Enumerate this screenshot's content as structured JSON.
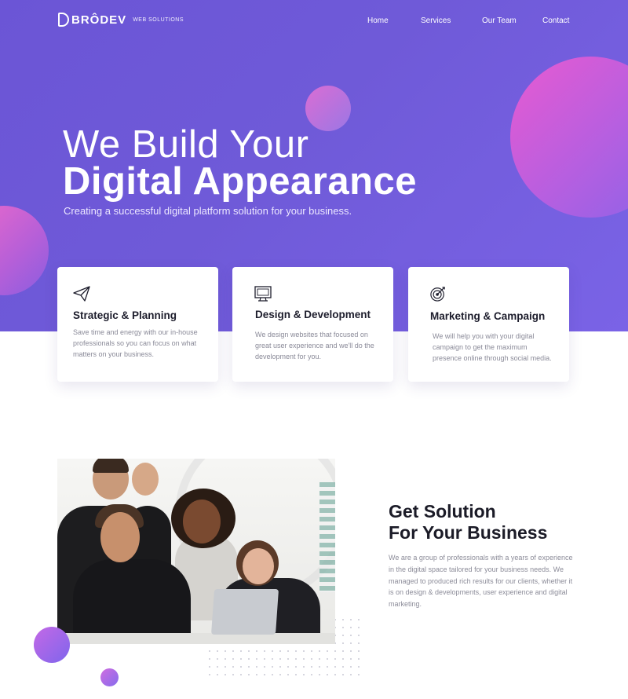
{
  "header": {
    "logo_text": "BRÔDEV",
    "logo_sub": "WEB SOLUTIONS",
    "nav": {
      "home": "Home",
      "services": "Services",
      "team": "Our Team",
      "contact": "Contact"
    }
  },
  "hero": {
    "title_line1": "We Build Your",
    "title_line2": "Digital Appearance",
    "subtitle": "Creating a successful digital platform solution for your business."
  },
  "services": {
    "items": [
      {
        "icon": "paper-plane-icon",
        "title": "Strategic & Planning",
        "text": "Save time and energy with our in-house professionals so you can focus on what matters on your business."
      },
      {
        "icon": "monitor-code-icon",
        "title": "Design & Development",
        "text": "We design websites that focused on great user experience and we'll do the development for you."
      },
      {
        "icon": "target-icon",
        "title": "Marketing & Campaign",
        "text": "We will help you with your digital campaign to get the maximum presence online through social media."
      }
    ]
  },
  "about": {
    "title_line1": "Get Solution",
    "title_line2": "For Your Business",
    "text": "We are a group of professionals with a years of experience in the digital space tailored for your business needs. We managed to produced rich results for our clients, whether it is on design & developments, user experience and digital marketing."
  },
  "colors": {
    "hero_gradient_start": "#6b55d6",
    "hero_gradient_end": "#7a63e6",
    "accent_pink": "#e85ad1",
    "heading_dark": "#1b1b27",
    "body_gray": "#8a8a98"
  }
}
